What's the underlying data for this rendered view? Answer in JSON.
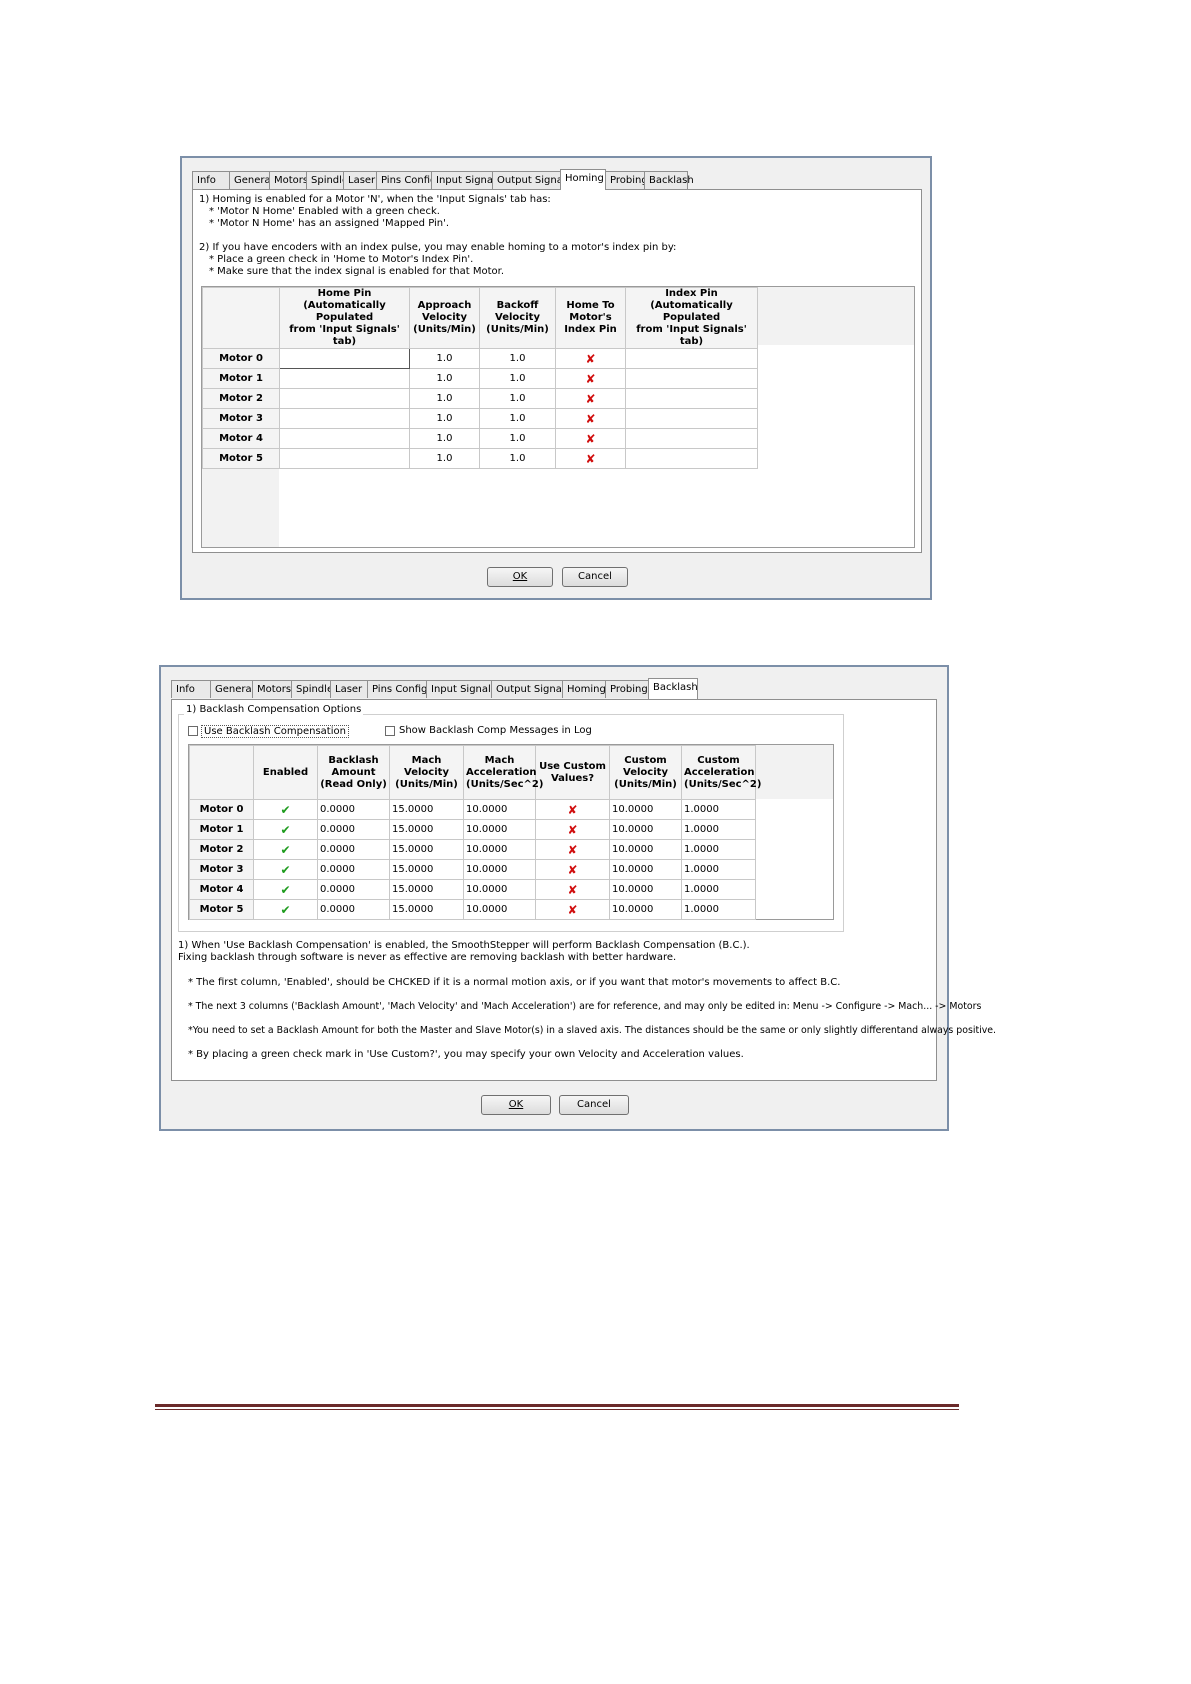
{
  "homing_dialog": {
    "tabs": [
      "Info",
      "General",
      "Motors",
      "Spindle",
      "Laser",
      "Pins Config",
      "Input Signals",
      "Output Signals",
      "Homing",
      "Probing",
      "Backlash"
    ],
    "active_tab": "Homing",
    "instructions": [
      "1) Homing is enabled for a Motor 'N', when the 'Input Signals' tab has:",
      "* 'Motor N Home' Enabled with a green check.",
      "* 'Motor N Home' has an assigned 'Mapped Pin'.",
      "2) If you have encoders with an index pulse, you may enable homing to a motor's index pin by:",
      "* Place a green check in 'Home to Motor's Index Pin'.",
      "* Make sure that the index signal is enabled for that Motor."
    ],
    "columns": [
      {
        "l1": "Home Pin",
        "l2": "(Automatically Populated",
        "l3": "from 'Input Signals' tab)"
      },
      {
        "l1": "Approach",
        "l2": "Velocity",
        "l3": "(Units/Min)"
      },
      {
        "l1": "Backoff",
        "l2": "Velocity",
        "l3": "(Units/Min)"
      },
      {
        "l1": "Home To",
        "l2": "Motor's",
        "l3": "Index Pin"
      },
      {
        "l1": "Index Pin",
        "l2": "(Automatically Populated",
        "l3": "from 'Input Signals' tab)"
      }
    ],
    "rows": [
      {
        "motor": "Motor 0",
        "home_pin": "",
        "approach": "1.0",
        "backoff": "1.0",
        "index_pin": ""
      },
      {
        "motor": "Motor 1",
        "home_pin": "",
        "approach": "1.0",
        "backoff": "1.0",
        "index_pin": ""
      },
      {
        "motor": "Motor 2",
        "home_pin": "",
        "approach": "1.0",
        "backoff": "1.0",
        "index_pin": ""
      },
      {
        "motor": "Motor 3",
        "home_pin": "",
        "approach": "1.0",
        "backoff": "1.0",
        "index_pin": ""
      },
      {
        "motor": "Motor 4",
        "home_pin": "",
        "approach": "1.0",
        "backoff": "1.0",
        "index_pin": ""
      },
      {
        "motor": "Motor 5",
        "home_pin": "",
        "approach": "1.0",
        "backoff": "1.0",
        "index_pin": ""
      }
    ],
    "ok_label": "OK",
    "cancel_label": "Cancel"
  },
  "backlash_dialog": {
    "tabs": [
      "Info",
      "General",
      "Motors",
      "Spindle",
      "Laser",
      "Pins Config",
      "Input Signals",
      "Output Signals",
      "Homing",
      "Probing",
      "Backlash"
    ],
    "active_tab": "Backlash",
    "group_title": "1) Backlash Compensation Options",
    "use_backlash_label": "Use Backlash Compensation",
    "show_messages_label": "Show Backlash Comp Messages in Log",
    "columns": [
      {
        "l1": "Enabled",
        "l2": "",
        "l3": ""
      },
      {
        "l1": "Backlash",
        "l2": "Amount",
        "l3": "(Read Only)"
      },
      {
        "l1": "Mach",
        "l2": "Velocity",
        "l3": "(Units/Min)"
      },
      {
        "l1": "Mach",
        "l2": "Acceleration",
        "l3": "(Units/Sec^2)"
      },
      {
        "l1": "Use Custom",
        "l2": "Values?",
        "l3": ""
      },
      {
        "l1": "Custom",
        "l2": "Velocity",
        "l3": "(Units/Min)"
      },
      {
        "l1": "Custom",
        "l2": "Acceleration",
        "l3": "(Units/Sec^2)"
      }
    ],
    "rows": [
      {
        "motor": "Motor 0",
        "amount": "0.0000",
        "mach_vel": "15.0000",
        "mach_acc": "10.0000",
        "cust_vel": "10.0000",
        "cust_acc": "1.0000"
      },
      {
        "motor": "Motor 1",
        "amount": "0.0000",
        "mach_vel": "15.0000",
        "mach_acc": "10.0000",
        "cust_vel": "10.0000",
        "cust_acc": "1.0000"
      },
      {
        "motor": "Motor 2",
        "amount": "0.0000",
        "mach_vel": "15.0000",
        "mach_acc": "10.0000",
        "cust_vel": "10.0000",
        "cust_acc": "1.0000"
      },
      {
        "motor": "Motor 3",
        "amount": "0.0000",
        "mach_vel": "15.0000",
        "mach_acc": "10.0000",
        "cust_vel": "10.0000",
        "cust_acc": "1.0000"
      },
      {
        "motor": "Motor 4",
        "amount": "0.0000",
        "mach_vel": "15.0000",
        "mach_acc": "10.0000",
        "cust_vel": "10.0000",
        "cust_acc": "1.0000"
      },
      {
        "motor": "Motor 5",
        "amount": "0.0000",
        "mach_vel": "15.0000",
        "mach_acc": "10.0000",
        "cust_vel": "10.0000",
        "cust_acc": "1.0000"
      }
    ],
    "notes": [
      "1) When 'Use Backlash Compensation' is enabled, the SmoothStepper will perform Backlash Compensation (B.C.).",
      "Fixing backlash through software is never as effective are removing backlash with better hardware.",
      "* The first column, 'Enabled', should be CHCKED if it is a normal motion axis, or if you want that motor's movements to affect B.C.",
      "* The next 3 columns ('Backlash Amount', 'Mach Velocity' and 'Mach Acceleration') are for reference, and may only be edited in:    Menu -> Configure -> Mach... -> Motors",
      "*You need to set a Backlash Amount for both the Master and Slave Motor(s) in a slaved axis.  The distances should be the same or only  slightly differentand always positive.",
      "* By placing a green check mark in 'Use Custom?', you may specify your own Velocity and Acceleration values."
    ],
    "ok_label": "OK",
    "cancel_label": "Cancel"
  },
  "icons": {
    "unchecked": "red-x-icon",
    "checked": "green-check-icon"
  },
  "colors": {
    "footer_rule": "#6b2a2a",
    "x_red": "#d10f0f",
    "check_green": "#1e9b1e",
    "window_border": "#7c8fa8"
  }
}
